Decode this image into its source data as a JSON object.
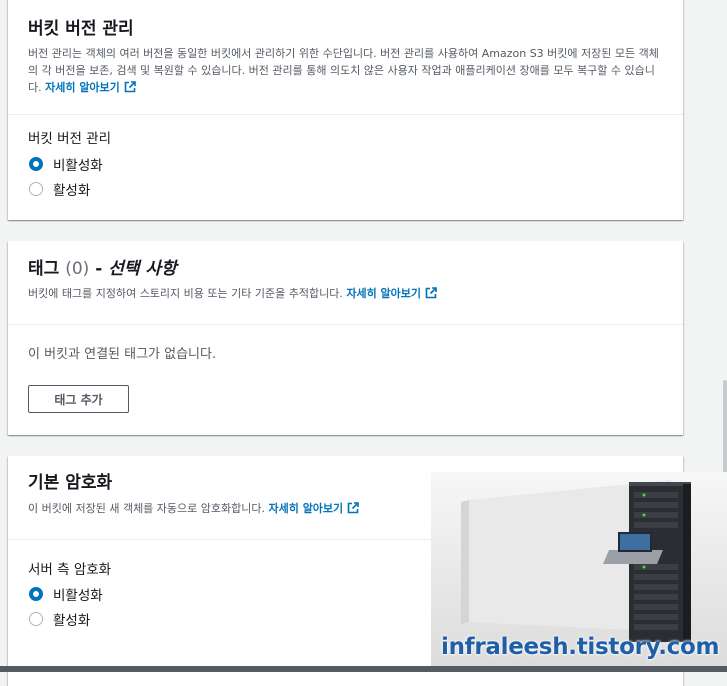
{
  "versioning": {
    "title": "버킷 버전 관리",
    "description": "버전 관리는 객체의 여러 버전을 동일한 버킷에서 관리하기 위한 수단입니다. 버전 관리를 사용하여 Amazon S3 버킷에 저장된 모든 객체의 각 버전을 보존, 검색 및 복원할 수 있습니다. 버전 관리를 통해 의도치 않은 사용자 작업과 애플리케이션 장애를 모두 복구할 수 있습니다.",
    "learn_more": "자세히 알아보기",
    "field_label": "버킷 버전 관리",
    "options": [
      "비활성화",
      "활성화"
    ],
    "selected": "비활성화"
  },
  "tags": {
    "title": "태그",
    "count": "(0)",
    "dash": " - ",
    "optional": "선택 사항",
    "description": "버킷에 태그를 지정하여 스토리지 비용 또는 기타 기준을 추적합니다.",
    "learn_more": "자세히 알아보기",
    "empty_text": "이 버킷과 연결된 태그가 없습니다.",
    "add_button": "태그 추가"
  },
  "encryption": {
    "title": "기본 암호화",
    "description": "이 버킷에 저장된 새 객체를 자동으로 암호화합니다.",
    "learn_more": "자세히 알아보기",
    "field_label": "서버 측 암호화",
    "options": [
      "비활성화",
      "활성화"
    ],
    "selected": "비활성화"
  },
  "watermark": {
    "text": "infraleesh.tistory.com"
  },
  "colors": {
    "link": "#0073bb",
    "radio_selected": "#0073bb",
    "background": "#f2f3f3"
  },
  "icons": {
    "external": "external-link-icon"
  }
}
